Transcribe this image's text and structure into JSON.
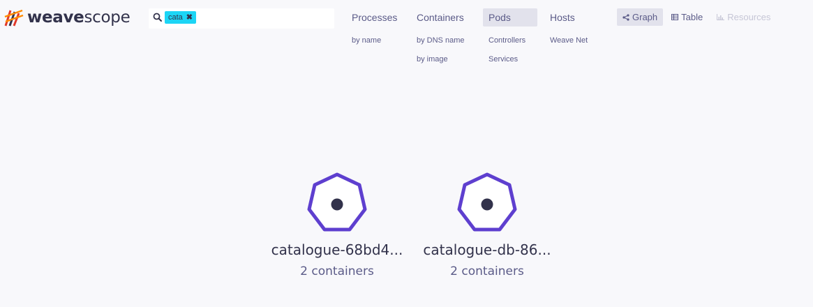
{
  "app": {
    "logo_bold": "weave",
    "logo_light": "scope"
  },
  "search": {
    "tag": "cata",
    "value": "",
    "placeholder": ""
  },
  "topologies": [
    {
      "label": "Processes",
      "active": false,
      "subs": [
        "by name"
      ]
    },
    {
      "label": "Containers",
      "active": false,
      "subs": [
        "by DNS name",
        "by image"
      ]
    },
    {
      "label": "Pods",
      "active": true,
      "subs": [
        "Controllers",
        "Services"
      ]
    },
    {
      "label": "Hosts",
      "active": false,
      "subs": [
        "Weave Net"
      ]
    }
  ],
  "views": {
    "graph": "Graph",
    "table": "Table",
    "resources": "Resources"
  },
  "nodes": [
    {
      "label": "catalogue-68bd4...",
      "sublabel": "2 containers"
    },
    {
      "label": "catalogue-db-86...",
      "sublabel": "2 containers"
    }
  ],
  "colors": {
    "node_stroke": "#5e3fcf",
    "accent_tag": "#1cd5f5",
    "background": "#f8f8fb"
  }
}
